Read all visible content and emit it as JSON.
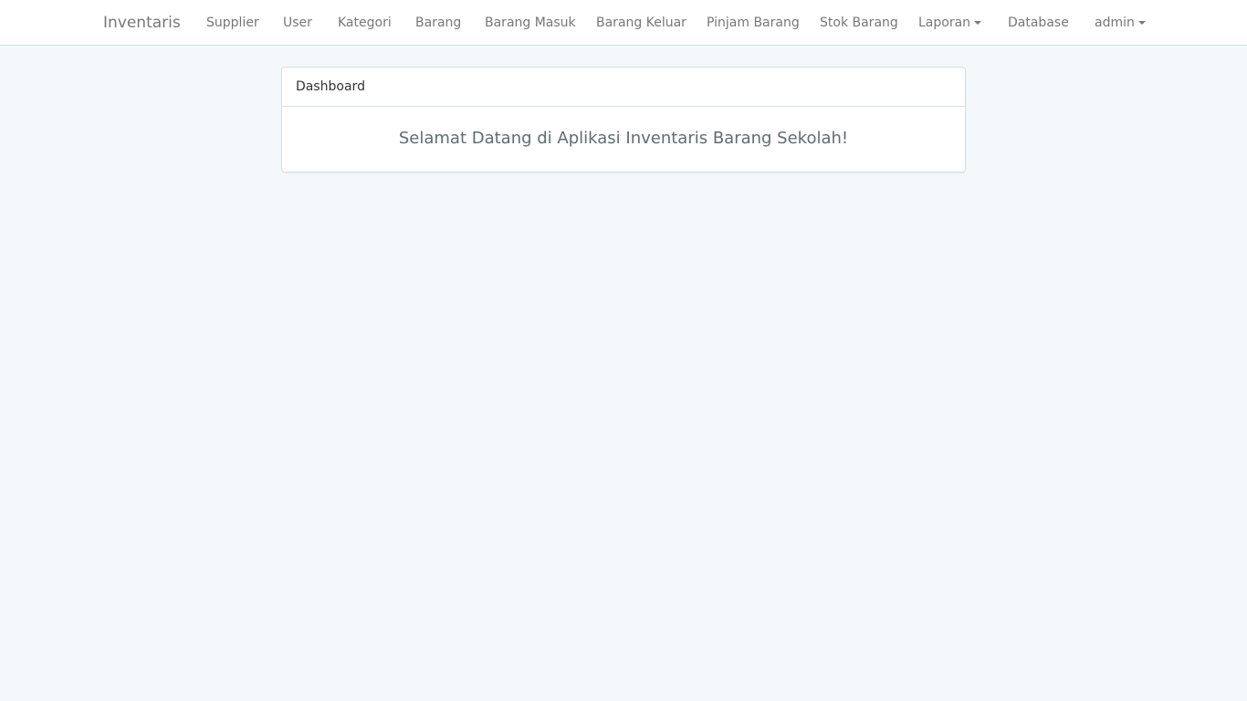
{
  "navbar": {
    "brand": "Inventaris",
    "items": [
      {
        "label": "Supplier"
      },
      {
        "label": "User"
      },
      {
        "label": "Kategori"
      },
      {
        "label": "Barang"
      },
      {
        "label": "Barang Masuk"
      },
      {
        "label": "Barang Keluar"
      },
      {
        "label": "Pinjam Barang"
      },
      {
        "label": "Stok Barang"
      },
      {
        "label": "Laporan"
      },
      {
        "label": "Database"
      }
    ],
    "user": {
      "label": "admin"
    }
  },
  "dashboard": {
    "heading": "Dashboard",
    "welcome": "Selamat Datang di Aplikasi Inventaris Barang Sekolah!"
  },
  "icons": {
    "laporan_caret": "caret-down-icon",
    "user_caret": "caret-down-icon"
  },
  "colors": {
    "background": "#f4f8fa",
    "navbar_background": "#ffffff",
    "border": "#d3e0e9",
    "nav_text": "#777777"
  }
}
